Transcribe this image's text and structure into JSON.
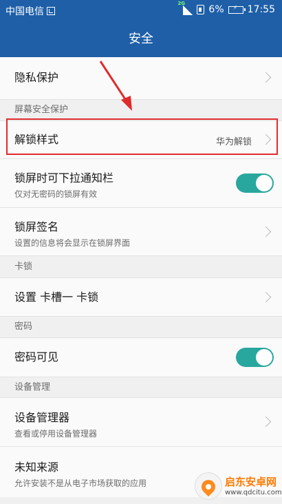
{
  "status_bar": {
    "carrier": "中国电信",
    "network_tag": "2G",
    "battery": "6%",
    "time": "17:55"
  },
  "header": {
    "title": "安全"
  },
  "items": {
    "privacy": {
      "title": "隐私保护"
    },
    "section_screen_security": "屏幕安全保护",
    "unlock_style": {
      "title": "解锁样式",
      "value": "华为解锁"
    },
    "lockscreen_notifications": {
      "title": "锁屏时可下拉通知栏",
      "subtitle": "仅对无密码的锁屏有效",
      "toggle_on": true
    },
    "lockscreen_signature": {
      "title": "锁屏签名",
      "subtitle": "设置的信息将会显示在锁屏界面"
    },
    "section_sim_lock": "卡锁",
    "sim_lock": {
      "title": "设置 卡槽一 卡锁"
    },
    "section_password": "密码",
    "password_visible": {
      "title": "密码可见",
      "toggle_on": true
    },
    "section_device_admin": "设备管理",
    "device_admin": {
      "title": "设备管理器",
      "subtitle": "查看或停用设备管理器"
    },
    "unknown_sources": {
      "title": "未知来源",
      "subtitle": "允许安装不是从电子市场获取的应用"
    }
  },
  "watermark": {
    "title": "启东安卓网",
    "url": "www.qdcitu.com"
  },
  "colors": {
    "header": "#1e5fa8",
    "toggle_on": "#27a79e",
    "highlight": "#e02b2b"
  }
}
